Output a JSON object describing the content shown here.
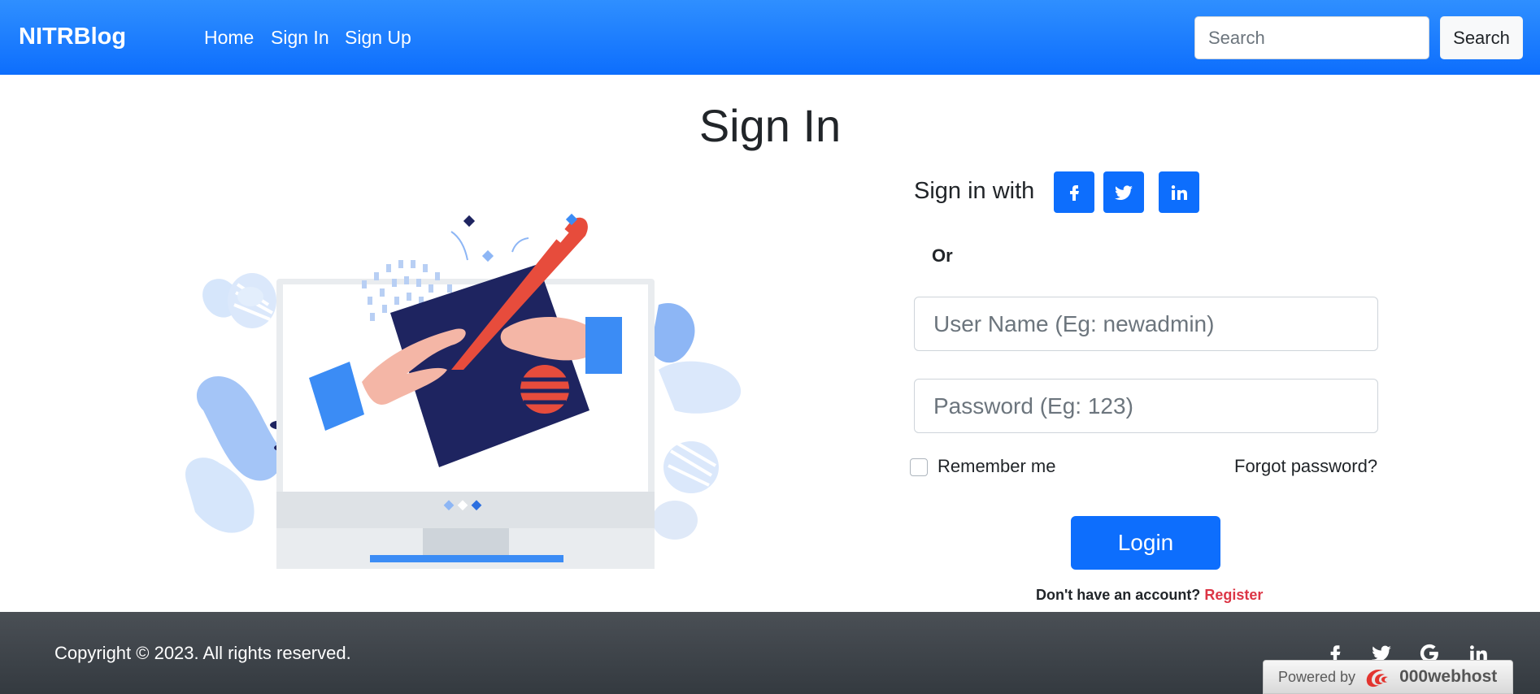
{
  "navbar": {
    "brand": "NITRBlog",
    "links": [
      "Home",
      "Sign In",
      "Sign Up"
    ],
    "search_placeholder": "Search",
    "search_button": "Search",
    "bg_color": "#0d6efd"
  },
  "main": {
    "title": "Sign In",
    "signin_with": "Sign in with",
    "social": [
      "facebook-icon",
      "twitter-icon",
      "linkedin-icon"
    ],
    "or": "Or",
    "username_placeholder": "User Name (Eg: newadmin)",
    "password_placeholder": "Password (Eg: 123)",
    "remember_label": "Remember me",
    "forgot_label": "Forgot password?",
    "login_label": "Login",
    "no_account_text": "Don't have an account?",
    "register_label": "Register",
    "accent_color": "#0d6efd",
    "register_color": "#dc3545"
  },
  "footer": {
    "copyright": "Copyright © 2023. All rights reserved.",
    "icons": [
      "facebook-icon",
      "twitter-icon",
      "google-icon",
      "linkedin-icon"
    ],
    "powered_by": "Powered by",
    "powered_brand": "000webhost"
  }
}
